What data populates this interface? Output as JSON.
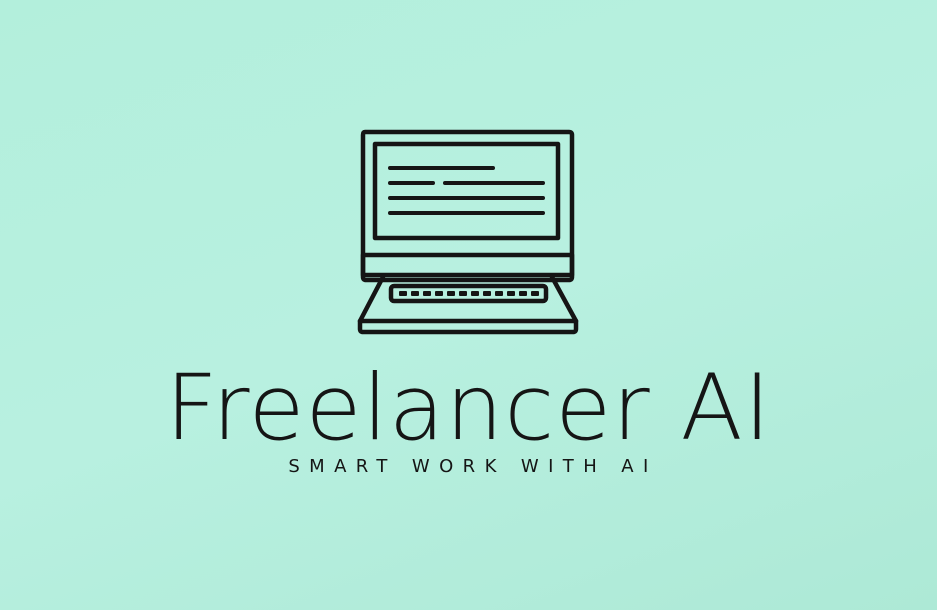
{
  "logo": {
    "brand_name": "Freelancer AI",
    "tagline": "SMART WORK WITH AI",
    "icon": "laptop-icon"
  },
  "colors": {
    "background": "#b3efdc",
    "ink": "#151515"
  }
}
